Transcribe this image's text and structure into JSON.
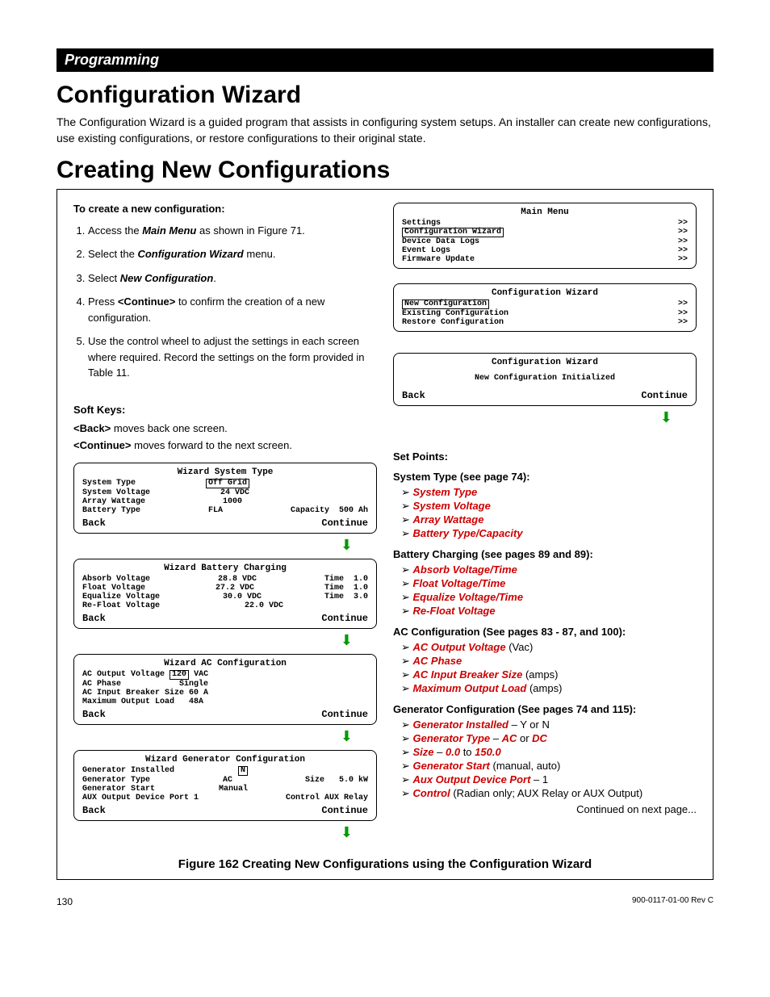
{
  "section_bar": "Programming",
  "title": "Configuration Wizard",
  "intro": "The Configuration Wizard is a guided program that assists in configuring system setups.  An installer can create new configurations, use existing configurations, or restore configurations to their original state.",
  "subtitle": "Creating New Configurations",
  "proc_head": "To create a new configuration:",
  "steps": {
    "s1a": "Access the ",
    "s1b": "Main Menu",
    "s1c": " as shown in Figure 71.",
    "s2a": "Select the ",
    "s2b": "Configuration Wizard",
    "s2c": " menu.",
    "s3a": "Select ",
    "s3b": "New Configuration",
    "s3c": ".",
    "s4a": "Press ",
    "s4b": "<Continue>",
    "s4c": " to confirm the creation of a new configuration.",
    "s5": "Use the control wheel to adjust the settings in each screen where required.  Record the settings on the form provided in Table 11."
  },
  "soft_keys_head": "Soft Keys:",
  "sk_back_a": "<Back>",
  "sk_back_b": " moves back one screen.",
  "sk_cont_a": "<Continue>",
  "sk_cont_b": " moves forward to the next screen.",
  "main_menu": {
    "title": "Main Menu",
    "items": [
      "Settings",
      "Configuration Wizard",
      "Device Data Logs",
      "Event Logs",
      "Firmware Update"
    ],
    "arrow": ">>"
  },
  "config_wizard": {
    "title": "Configuration Wizard",
    "items": [
      "New Configuration",
      "Existing Configuration",
      "Restore Configuration"
    ],
    "arrow": ">>"
  },
  "new_config": {
    "title": "Configuration Wizard",
    "msg": "New Configuration Initialized",
    "back": "Back",
    "cont": "Continue"
  },
  "screens": {
    "system": {
      "title": "Wizard System Type",
      "rows": {
        "r1a": "System Type",
        "r1b": "Off Grid",
        "r2a": "System Voltage",
        "r2b": "24 VDC",
        "r3a": "Array Wattage",
        "r3b": "1000",
        "r4a": "Battery Type",
        "r4b": "FLA",
        "r4c": "Capacity",
        "r4d": "500 Ah"
      },
      "back": "Back",
      "cont": "Continue"
    },
    "battery": {
      "title": "Wizard Battery Charging",
      "rows": {
        "r1a": "Absorb Voltage",
        "r1b": "28.8 VDC",
        "r1c": "Time",
        "r1d": "1.0",
        "r2a": "Float Voltage",
        "r2b": "27.2 VDC",
        "r2c": "Time",
        "r2d": "1.0",
        "r3a": "Equalize Voltage",
        "r3b": "30.0 VDC",
        "r3c": "Time",
        "r3d": "3.0",
        "r4a": "Re-Float Voltage",
        "r4b": "22.0 VDC"
      },
      "back": "Back",
      "cont": "Continue"
    },
    "ac": {
      "title": "Wizard AC Configuration",
      "rows": {
        "r1a": "AC Output Voltage",
        "r1b": "120",
        "r1c": "VAC",
        "r2a": "AC Phase",
        "r2b": "Single",
        "r3a": "AC Input Breaker Size",
        "r3b": "60 A",
        "r4a": "Maximum Output Load",
        "r4b": "48A"
      },
      "back": "Back",
      "cont": "Continue"
    },
    "gen": {
      "title": "Wizard Generator Configuration",
      "rows": {
        "r1a": "Generator Installed",
        "r1b": "N",
        "r2a": "Generator Type",
        "r2b": "AC",
        "r2c": "Size",
        "r2d": "5.0 kW",
        "r3a": "Generator Start",
        "r3b": "Manual",
        "r4a": "AUX Output Device Port 1",
        "r4b": "Control AUX Relay"
      },
      "back": "Back",
      "cont": "Continue"
    }
  },
  "setpoints_head": "Set Points:",
  "groups": {
    "system": {
      "head": "System Type (see page 74):",
      "items": [
        "System Type",
        "System Voltage",
        "Array Wattage",
        "Battery Type/Capacity"
      ]
    },
    "battery": {
      "head": "Battery Charging (see pages 89 and 89):",
      "items": [
        "Absorb Voltage/Time",
        "Float Voltage/Time",
        "Equalize Voltage/Time",
        "Re-Float Voltage"
      ]
    },
    "ac": {
      "head": "AC Configuration (See pages 83 - 87, and 100):",
      "items": [
        {
          "main": "AC Output Voltage",
          "suffix": " (Vac)"
        },
        {
          "main": "AC Phase",
          "suffix": ""
        },
        {
          "main": "AC Input Breaker Size",
          "suffix": " (amps)"
        },
        {
          "main": "Maximum Output Load",
          "suffix": " (amps)"
        }
      ]
    },
    "gen": {
      "head": "Generator  Configuration (See pages 74 and 115):",
      "i1a": "Generator Installed",
      "i1b": " – Y or N",
      "i2a": "Generator Type",
      "i2b": " – ",
      "i2c": "AC",
      "i2d": " or ",
      "i2e": "DC",
      "i3a": "Size",
      "i3b": " – ",
      "i3c": "0.0",
      "i3d": " to ",
      "i3e": "150.0",
      "i4a": "Generator Start",
      "i4b": " (manual, auto)",
      "i5a": "Aux Output Device Port",
      "i5b": " – 1",
      "i6a": "Control",
      "i6b": " (Radian only; AUX Relay or AUX Output)"
    }
  },
  "cont_note": "Continued on next page...",
  "figure_caption": "Figure 162    Creating New Configurations using the Configuration Wizard",
  "footer_page": "130",
  "footer_rev": "900-0117-01-00 Rev C"
}
